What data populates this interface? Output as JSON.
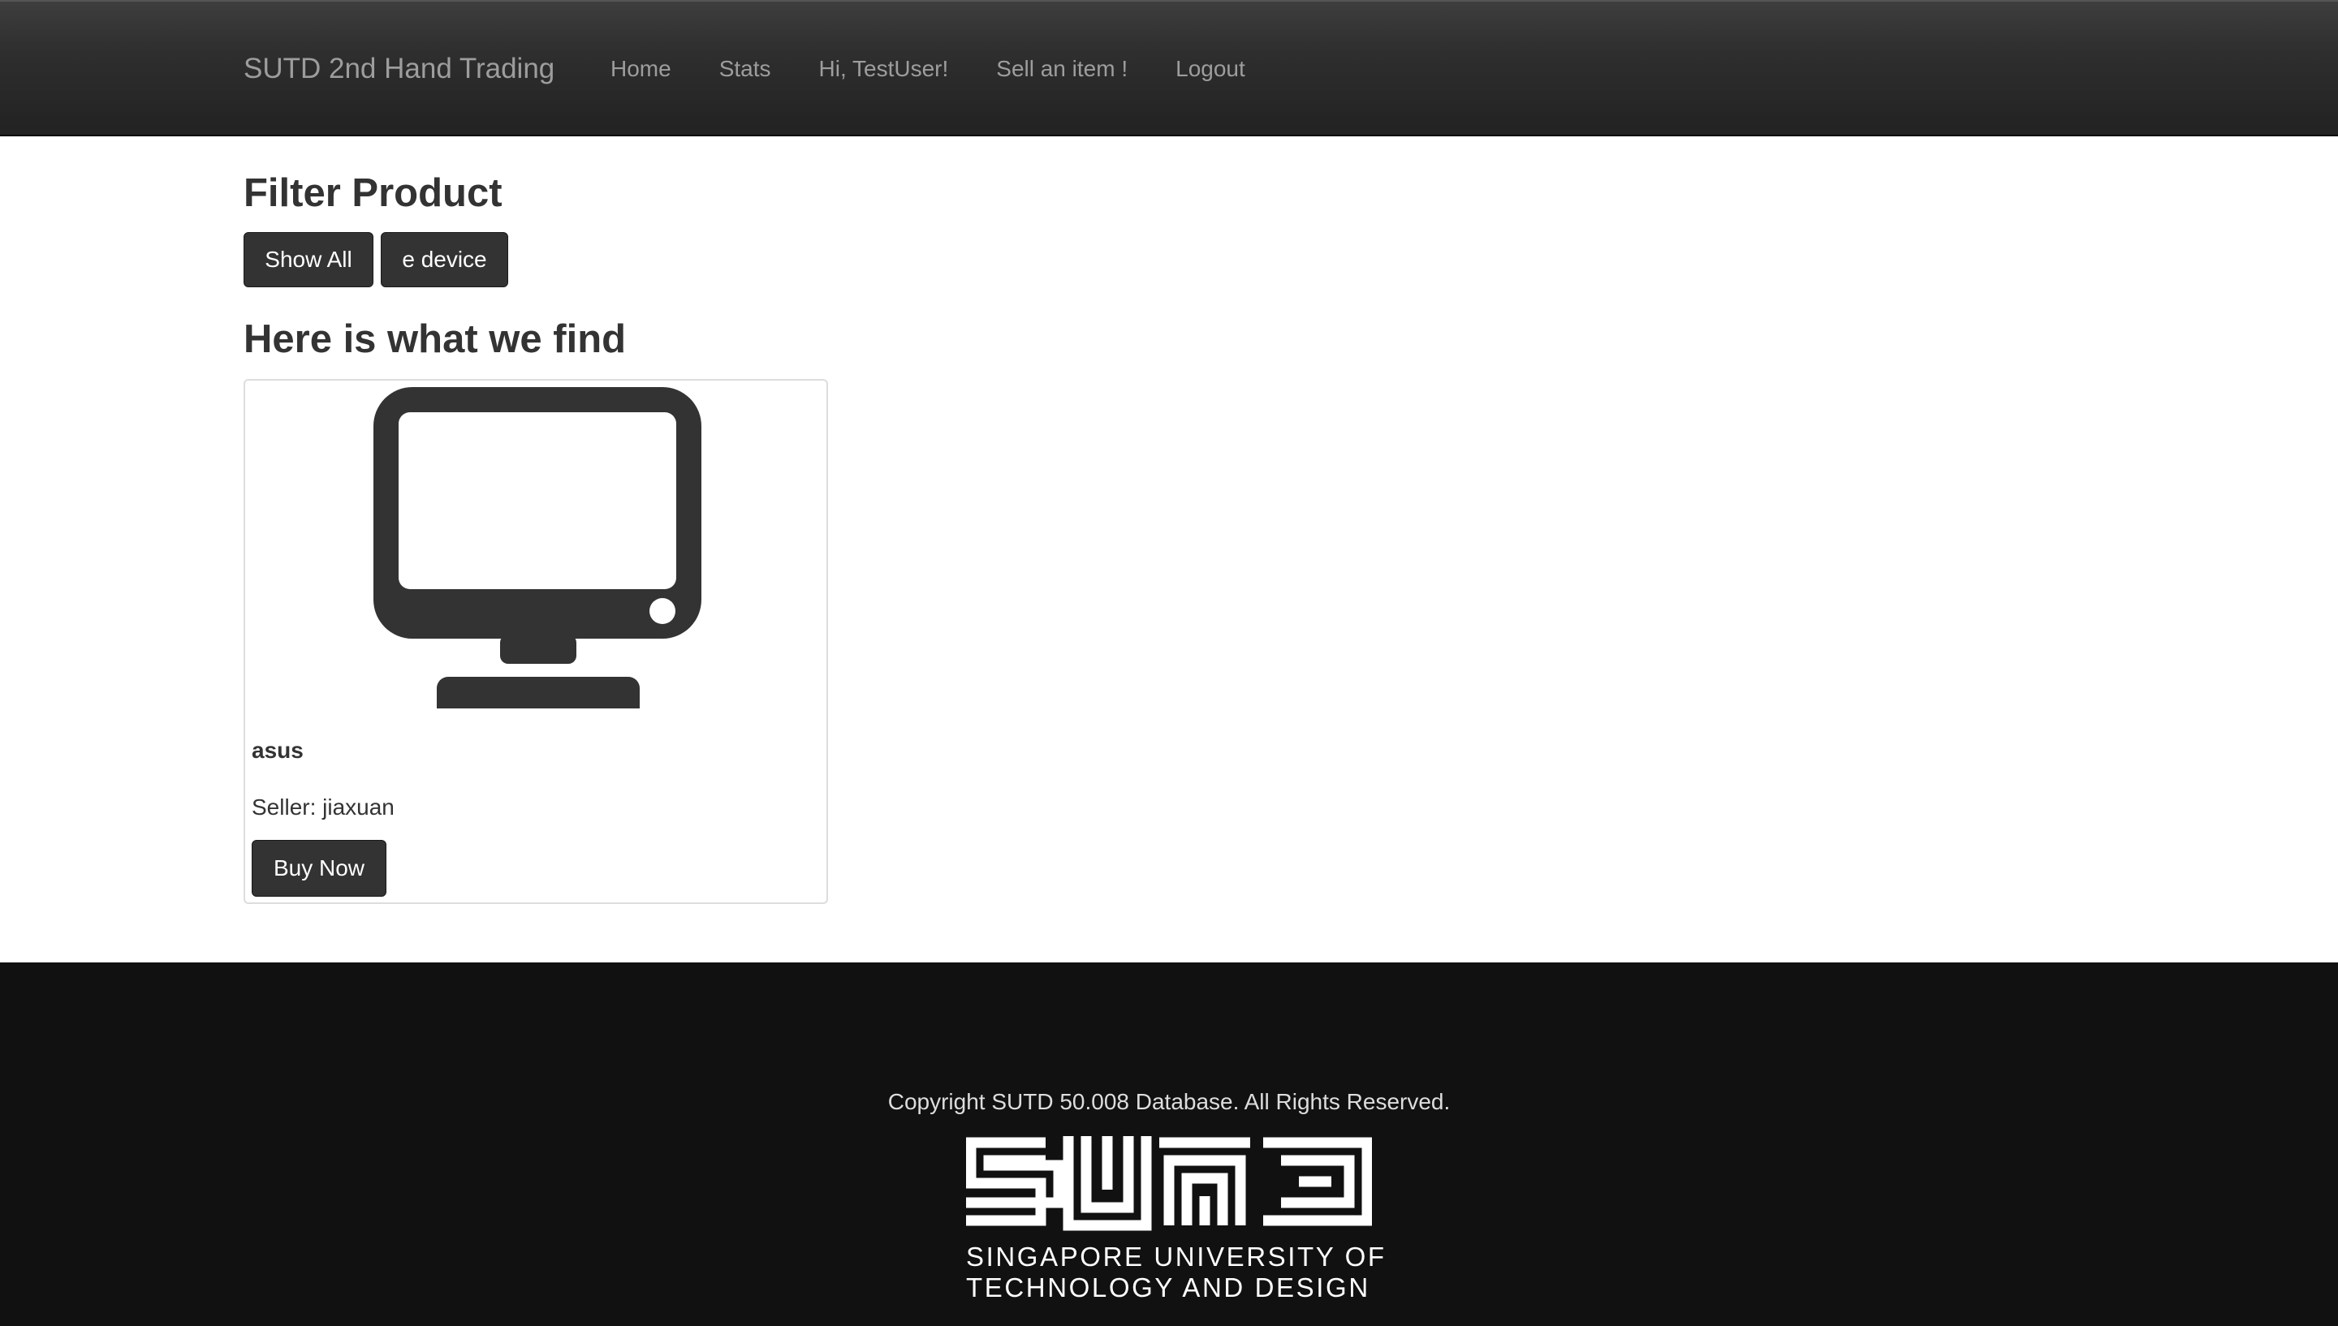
{
  "navbar": {
    "brand": "SUTD 2nd Hand Trading",
    "links": {
      "home": "Home",
      "stats": "Stats",
      "greeting": "Hi, TestUser!",
      "sell": "Sell an item !",
      "logout": "Logout"
    }
  },
  "filter": {
    "title": "Filter Product",
    "buttons": {
      "show_all": "Show All",
      "e_device": "e device"
    }
  },
  "results": {
    "title": "Here is what we find",
    "products": [
      {
        "icon": "desktop-monitor-icon",
        "name": "asus",
        "seller": "Seller: jiaxuan",
        "buy_label": "Buy Now"
      }
    ]
  },
  "footer": {
    "copyright": "Copyright SUTD 50.008 Database. All Rights Reserved.",
    "logo_caption_line1": "SINGAPORE UNIVERSITY OF",
    "logo_caption_line2": "TECHNOLOGY AND DESIGN"
  },
  "colors": {
    "navbar_bg": "#222222",
    "nav_text": "#9d9d9d",
    "button_bg": "#333333",
    "footer_bg": "#111111"
  }
}
